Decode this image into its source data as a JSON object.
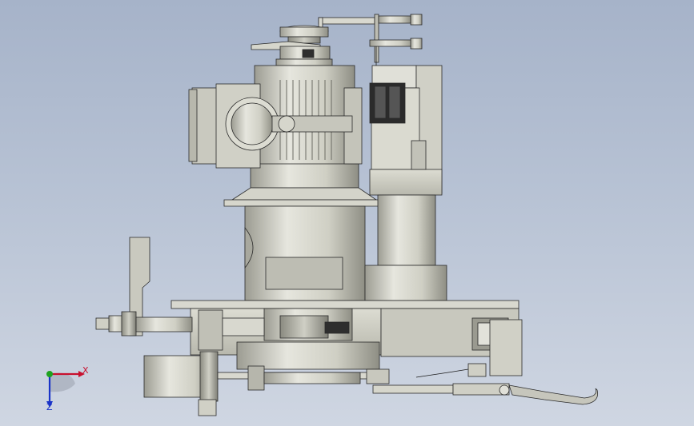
{
  "viewport": {
    "background_top": "#a6b3c9",
    "background_bottom": "#cfd6e2"
  },
  "model": {
    "metal_color": "#cfcfc4",
    "edge_color": "#2a2a2a",
    "dark_color": "#1c1c1c"
  },
  "triad": {
    "x_label": "X",
    "z_label": "Z",
    "x_color": "#c8102e",
    "y_color": "#1fa21f",
    "z_color": "#1a33c8"
  }
}
